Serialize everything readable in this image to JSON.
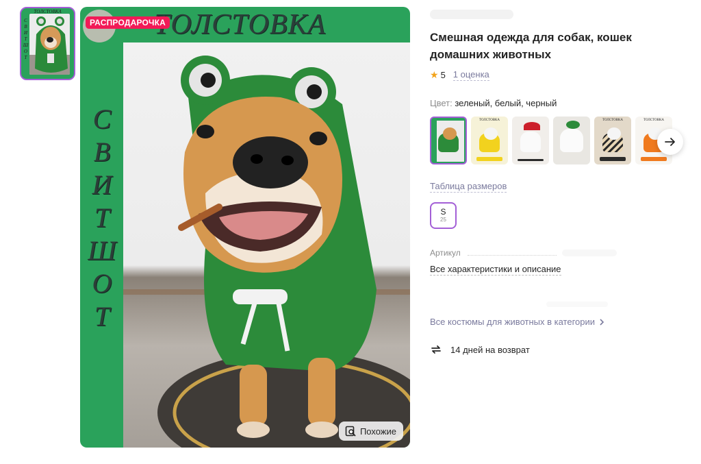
{
  "thumbnail": {
    "title": "ТОЛСТОВКА",
    "vertical": "СВИТШОТ"
  },
  "main_image": {
    "badge": "РАСПРОДАРОЧКА",
    "title": "ТОЛСТОВКА",
    "vertical_letters": [
      "С",
      "В",
      "И",
      "Т",
      "Ш",
      "О",
      "Т"
    ],
    "similar_label": "Похожие",
    "similar_icon": "search-similar-icon"
  },
  "product": {
    "title_line1": "Смешная одежда для собак, кошек",
    "title_line2": "домашних животных",
    "rating": "5",
    "rating_icon": "star-icon",
    "reviews_link": "1 оценка",
    "color_key": "Цвет:",
    "color_value": " зеленый, белый, черный",
    "swatch_labels": [
      "",
      "ТОЛСТОВКА",
      "ТОЛСТОВКА",
      "",
      "ТОЛСТОВКА",
      "ТОЛСТОВКА"
    ],
    "size_table_link": "Таблица размеров",
    "size": {
      "label": "S",
      "sub": "25"
    },
    "article_label": "Артикул",
    "all_specs_link": "Все характеристики и описание",
    "category_link": "Все костюмы для животных в категории",
    "return_text": "14 дней на возврат",
    "return_icon": "return-arrows-icon"
  },
  "colors": {
    "accent": "#a35fd6",
    "sale": "#f21a57",
    "frame_green": "#2aa25b",
    "link": "#7a7a9d"
  }
}
